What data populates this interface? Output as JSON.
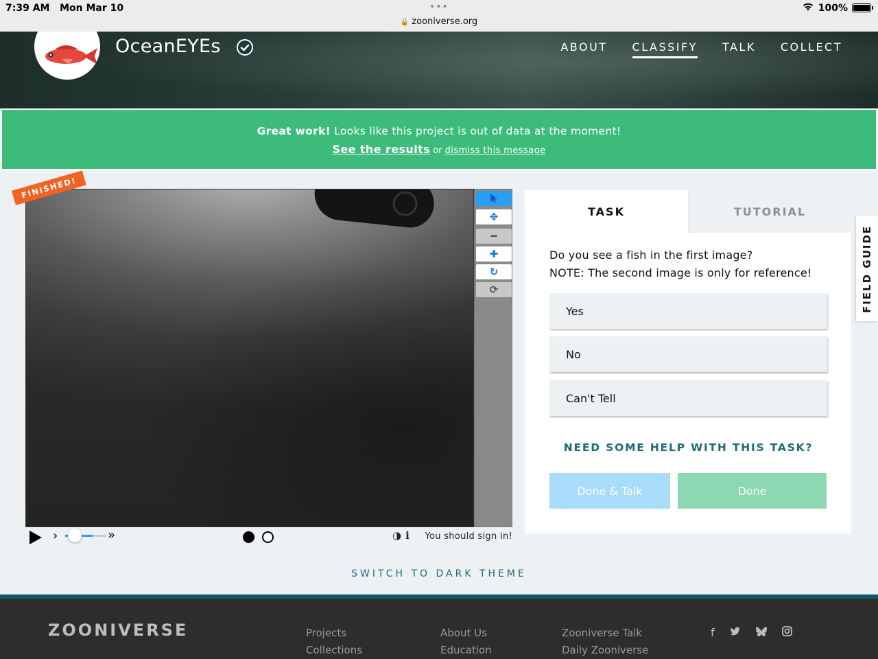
{
  "statusbar": {
    "time": "7:39 AM",
    "date": "Mon Mar 10",
    "dots": "•••",
    "url": "zooniverse.org",
    "battery": "100%"
  },
  "header": {
    "title": "OceanEYEs",
    "nav": [
      {
        "label": "ABOUT"
      },
      {
        "label": "CLASSIFY"
      },
      {
        "label": "TALK"
      },
      {
        "label": "COLLECT"
      }
    ]
  },
  "banner": {
    "bold": "Great work!",
    "message": " Looks like this project is out of data at the moment!",
    "results_link": "See the results",
    "or": " or ",
    "dismiss_link": "dismiss this message"
  },
  "viewer": {
    "finished_label": "FINISHED!",
    "signin": "You should sign in!"
  },
  "task": {
    "tab_task": "TASK",
    "tab_tutorial": "TUTORIAL",
    "question_line1": "Do you see a fish in the first image?",
    "question_line2": "NOTE: The second image is only for reference!",
    "answers": [
      "Yes",
      "No",
      "Can't Tell"
    ],
    "help": "NEED SOME HELP WITH THIS TASK?",
    "done_talk": "Done & Talk",
    "done": "Done"
  },
  "field_guide": "FIELD GUIDE",
  "dark_theme": "SWITCH TO DARK THEME",
  "footer": {
    "logo": "ZOONIVERSE",
    "col1": [
      "Projects",
      "Collections"
    ],
    "col2": [
      "About Us",
      "Education"
    ],
    "col3": [
      "Zooniverse Talk",
      "Daily Zooniverse"
    ]
  },
  "colors": {
    "banner_green": "#3cbb7b",
    "accent_teal": "#1c6b76",
    "finished_orange": "#f26323",
    "done_green": "#8cd8b2",
    "done_talk_blue": "#a9dcfa"
  }
}
